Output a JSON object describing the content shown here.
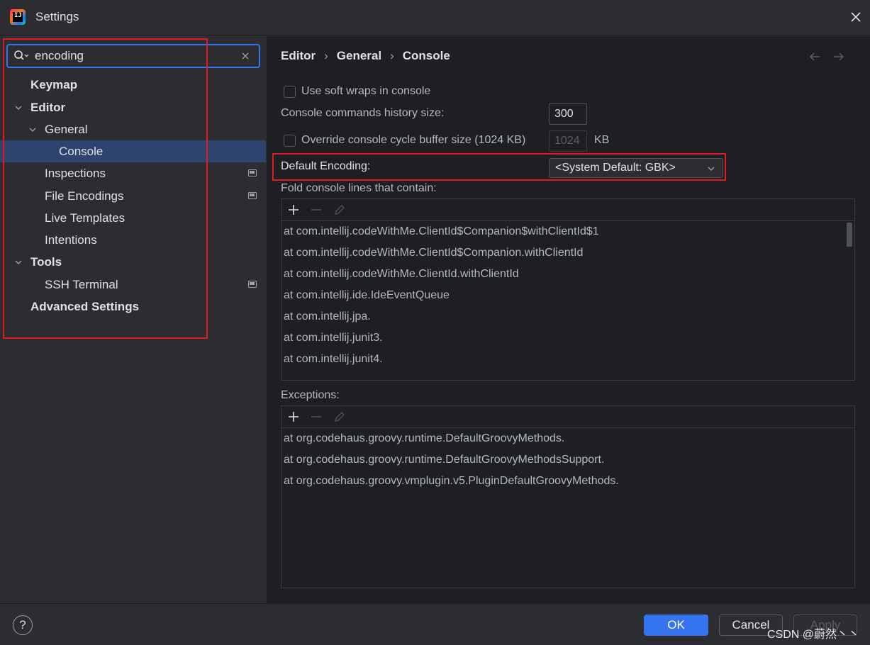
{
  "window": {
    "title": "Settings"
  },
  "search": {
    "value": "encoding"
  },
  "sidebar": {
    "items": [
      {
        "label": "Keymap"
      },
      {
        "label": "Editor"
      },
      {
        "label": "General"
      },
      {
        "label": "Console"
      },
      {
        "label": "Inspections"
      },
      {
        "label": "File Encodings"
      },
      {
        "label": "Live Templates"
      },
      {
        "label": "Intentions"
      },
      {
        "label": "Tools"
      },
      {
        "label": "SSH Terminal"
      },
      {
        "label": "Advanced Settings"
      }
    ]
  },
  "breadcrumb": [
    "Editor",
    "General",
    "Console"
  ],
  "console": {
    "soft_wraps_label": "Use soft wraps in console",
    "soft_wraps_checked": false,
    "history_label": "Console commands history size:",
    "history_value": "300",
    "override_label": "Override console cycle buffer size (1024 KB)",
    "override_checked": false,
    "override_value": "1024",
    "override_unit": "KB",
    "encoding_label": "Default Encoding:",
    "encoding_value": "<System Default: GBK>",
    "fold_label": "Fold console lines that contain:",
    "fold_lines": [
      "at com.intellij.codeWithMe.ClientId$Companion$withClientId$1",
      "at com.intellij.codeWithMe.ClientId$Companion.withClientId",
      "at com.intellij.codeWithMe.ClientId.withClientId",
      "at com.intellij.ide.IdeEventQueue",
      "at com.intellij.jpa.",
      "at com.intellij.junit3.",
      "at com.intellij.junit4."
    ],
    "exceptions_label": "Exceptions:",
    "exception_lines": [
      "at org.codehaus.groovy.runtime.DefaultGroovyMethods.",
      "at org.codehaus.groovy.runtime.DefaultGroovyMethodsSupport.",
      "at org.codehaus.groovy.vmplugin.v5.PluginDefaultGroovyMethods."
    ]
  },
  "footer": {
    "help": "?",
    "ok": "OK",
    "cancel": "Cancel",
    "apply": "Apply",
    "watermark": "CSDN @蔚然丶丶"
  },
  "colors": {
    "accent": "#3574f0",
    "highlight_box": "#e01b24",
    "selection": "#2e436e"
  }
}
